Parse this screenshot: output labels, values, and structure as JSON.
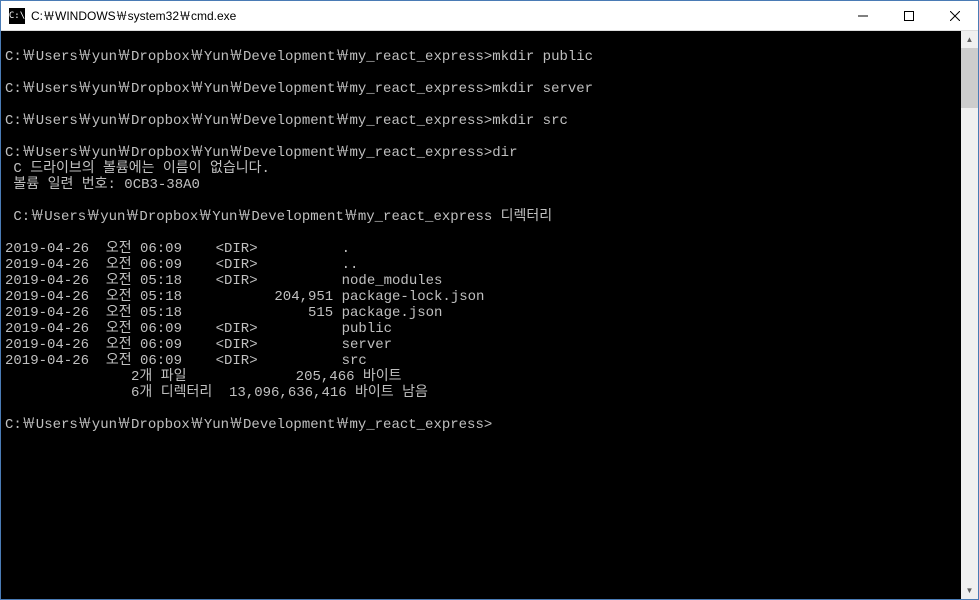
{
  "titlebar": {
    "icon_text": "C:\\",
    "title": "C:￦WINDOWS￦system32￦cmd.exe"
  },
  "terminal": {
    "lines": [
      "",
      "C:￦Users￦yun￦Dropbox￦Yun￦Development￦my_react_express>mkdir public",
      "",
      "C:￦Users￦yun￦Dropbox￦Yun￦Development￦my_react_express>mkdir server",
      "",
      "C:￦Users￦yun￦Dropbox￦Yun￦Development￦my_react_express>mkdir src",
      "",
      "C:￦Users￦yun￦Dropbox￦Yun￦Development￦my_react_express>dir",
      " C 드라이브의 볼륨에는 이름이 없습니다.",
      " 볼륨 일련 번호: 0CB3-38A0",
      "",
      " C:￦Users￦yun￦Dropbox￦Yun￦Development￦my_react_express 디렉터리",
      "",
      "2019-04-26  오전 06:09    <DIR>          .",
      "2019-04-26  오전 06:09    <DIR>          ..",
      "2019-04-26  오전 05:18    <DIR>          node_modules",
      "2019-04-26  오전 05:18           204,951 package-lock.json",
      "2019-04-26  오전 05:18               515 package.json",
      "2019-04-26  오전 06:09    <DIR>          public",
      "2019-04-26  오전 06:09    <DIR>          server",
      "2019-04-26  오전 06:09    <DIR>          src",
      "               2개 파일             205,466 바이트",
      "               6개 디렉터리  13,096,636,416 바이트 남음",
      "",
      "C:￦Users￦yun￦Dropbox￦Yun￦Development￦my_react_express>"
    ]
  }
}
